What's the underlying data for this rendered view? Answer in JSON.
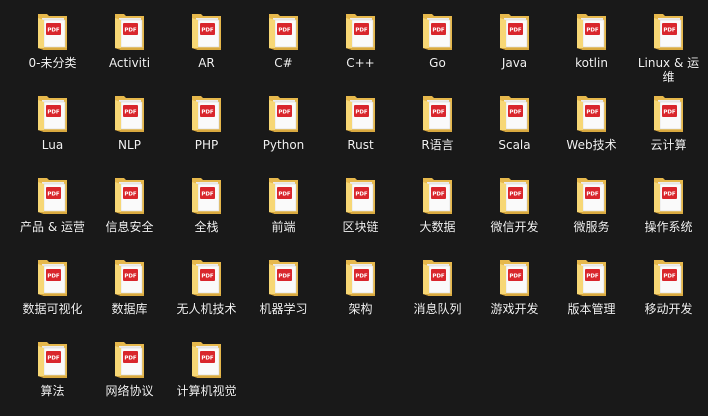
{
  "window": {
    "title": "",
    "view": "Large icons"
  },
  "colors": {
    "background": "#191919",
    "label_text": "#f3f3f3",
    "folder_back": "#e6b84c",
    "folder_front": "#f7d775",
    "paper": "#fafafa",
    "pdf_red": "#d9262c"
  },
  "items": [
    {
      "label": "0-未分类",
      "icon": "pdf-folder-icon",
      "type": "folder"
    },
    {
      "label": "Activiti",
      "icon": "pdf-folder-icon",
      "type": "folder"
    },
    {
      "label": "AR",
      "icon": "pdf-folder-icon",
      "type": "folder"
    },
    {
      "label": "C#",
      "icon": "pdf-folder-icon",
      "type": "folder"
    },
    {
      "label": "C++",
      "icon": "pdf-folder-icon",
      "type": "folder"
    },
    {
      "label": "Go",
      "icon": "pdf-folder-icon",
      "type": "folder"
    },
    {
      "label": "Java",
      "icon": "pdf-folder-icon",
      "type": "folder"
    },
    {
      "label": "kotlin",
      "icon": "pdf-folder-icon",
      "type": "folder"
    },
    {
      "label": "Linux & 运维",
      "icon": "pdf-folder-icon",
      "type": "folder"
    },
    {
      "label": "Lua",
      "icon": "pdf-folder-icon",
      "type": "folder"
    },
    {
      "label": "NLP",
      "icon": "pdf-folder-icon",
      "type": "folder"
    },
    {
      "label": "PHP",
      "icon": "pdf-folder-icon",
      "type": "folder"
    },
    {
      "label": "Python",
      "icon": "pdf-folder-icon",
      "type": "folder"
    },
    {
      "label": "Rust",
      "icon": "pdf-folder-icon",
      "type": "folder"
    },
    {
      "label": "R语言",
      "icon": "pdf-folder-icon",
      "type": "folder"
    },
    {
      "label": "Scala",
      "icon": "pdf-folder-icon",
      "type": "folder"
    },
    {
      "label": "Web技术",
      "icon": "pdf-folder-icon",
      "type": "folder"
    },
    {
      "label": "云计算",
      "icon": "pdf-folder-icon",
      "type": "folder"
    },
    {
      "label": "产品 & 运营",
      "icon": "pdf-folder-icon",
      "type": "folder"
    },
    {
      "label": "信息安全",
      "icon": "pdf-folder-icon",
      "type": "folder"
    },
    {
      "label": "全栈",
      "icon": "pdf-folder-icon",
      "type": "folder"
    },
    {
      "label": "前端",
      "icon": "pdf-folder-icon",
      "type": "folder"
    },
    {
      "label": "区块链",
      "icon": "pdf-folder-icon",
      "type": "folder"
    },
    {
      "label": "大数据",
      "icon": "pdf-folder-icon",
      "type": "folder"
    },
    {
      "label": "微信开发",
      "icon": "pdf-folder-icon",
      "type": "folder"
    },
    {
      "label": "微服务",
      "icon": "pdf-folder-icon",
      "type": "folder"
    },
    {
      "label": "操作系统",
      "icon": "pdf-folder-icon",
      "type": "folder"
    },
    {
      "label": "数据可视化",
      "icon": "pdf-folder-icon",
      "type": "folder"
    },
    {
      "label": "数据库",
      "icon": "pdf-folder-icon",
      "type": "folder"
    },
    {
      "label": "无人机技术",
      "icon": "pdf-folder-icon",
      "type": "folder"
    },
    {
      "label": "机器学习",
      "icon": "pdf-folder-icon",
      "type": "folder"
    },
    {
      "label": "架构",
      "icon": "pdf-folder-icon",
      "type": "folder"
    },
    {
      "label": "消息队列",
      "icon": "pdf-folder-icon",
      "type": "folder"
    },
    {
      "label": "游戏开发",
      "icon": "pdf-folder-icon",
      "type": "folder"
    },
    {
      "label": "版本管理",
      "icon": "pdf-folder-icon",
      "type": "folder"
    },
    {
      "label": "移动开发",
      "icon": "pdf-folder-icon",
      "type": "folder"
    },
    {
      "label": "算法",
      "icon": "pdf-folder-icon",
      "type": "folder"
    },
    {
      "label": "网络协议",
      "icon": "pdf-folder-icon",
      "type": "folder"
    },
    {
      "label": "计算机视觉",
      "icon": "pdf-folder-icon",
      "type": "folder"
    }
  ],
  "pdf_badge_text": "PDF"
}
